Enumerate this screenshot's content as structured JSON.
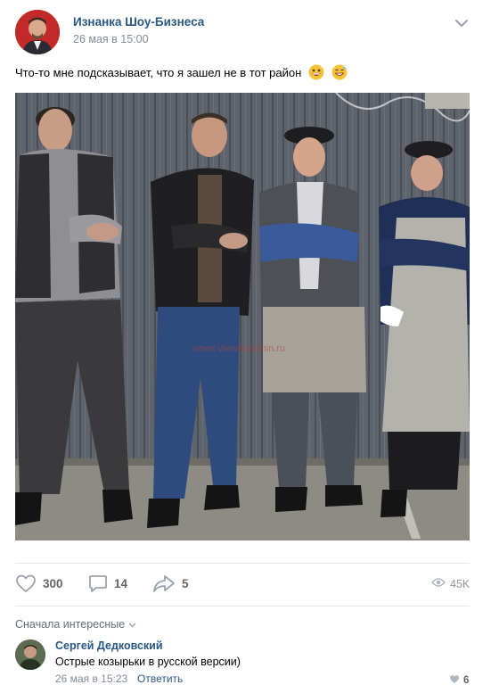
{
  "post": {
    "author": "Изнанка Шоу-Бизнеса",
    "date": "26 мая в 15:00",
    "text": "Что-то мне подсказывает, что я зашел не в тот район",
    "watermark": "www.ViewNaushin.ru"
  },
  "actions": {
    "likes": "300",
    "comments": "14",
    "shares": "5",
    "views": "45K"
  },
  "comments": {
    "sort_label": "Сначала интересные",
    "items": [
      {
        "author": "Сергей Дедковский",
        "text": "Острые козырьки в русской версии)",
        "date": "26 мая в 15:23",
        "reply": "Ответить",
        "likes": "6"
      }
    ]
  },
  "icons": {
    "like": "heart-icon",
    "comment": "comment-icon",
    "share": "share-icon",
    "views": "eye-icon",
    "menu": "chevron-down-icon"
  },
  "colors": {
    "link": "#2a5885",
    "muted": "#818c99",
    "counter": "#656565"
  }
}
